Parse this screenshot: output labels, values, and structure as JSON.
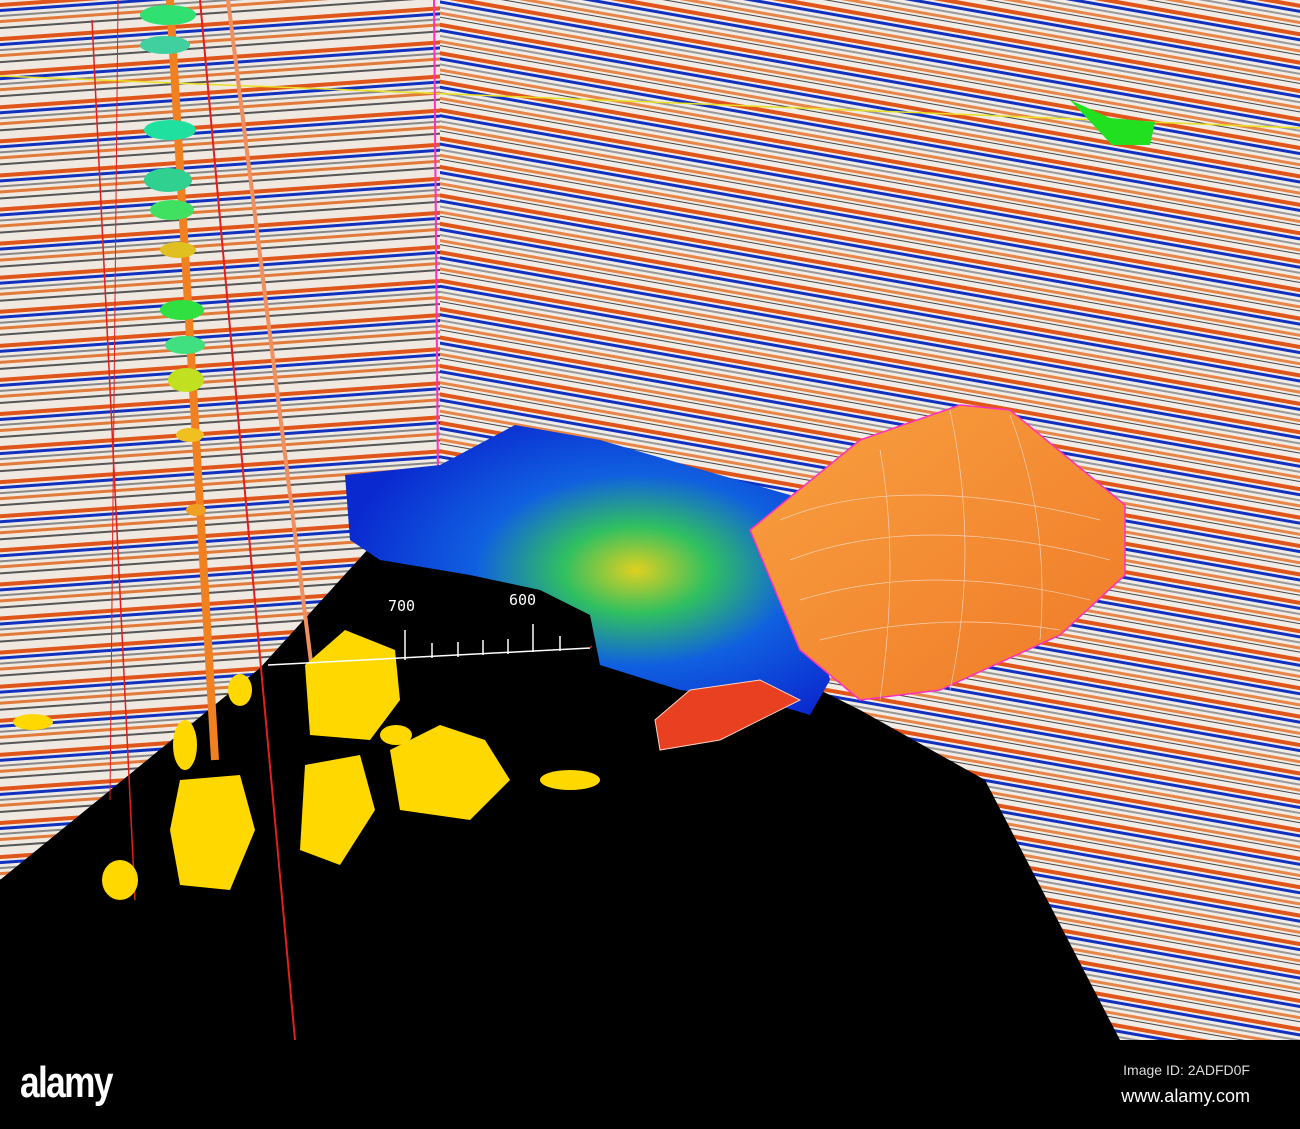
{
  "scene": {
    "axis_labels": [
      "700",
      "600"
    ],
    "colors": {
      "seismic_positive": "#e0561a",
      "seismic_negative": "#1030c0",
      "seismic_background": "#f0ece6",
      "amplitude_body": "#ffd800",
      "fault_surface": "#f5962e",
      "attribute_map_low": "#0a3ce0",
      "horizon_line": "#e8e020",
      "well_path": "#e02020"
    }
  },
  "watermark": {
    "logo": "alamy",
    "image_id": "Image ID: 2ADFD0F",
    "site": "www.alamy.com"
  }
}
